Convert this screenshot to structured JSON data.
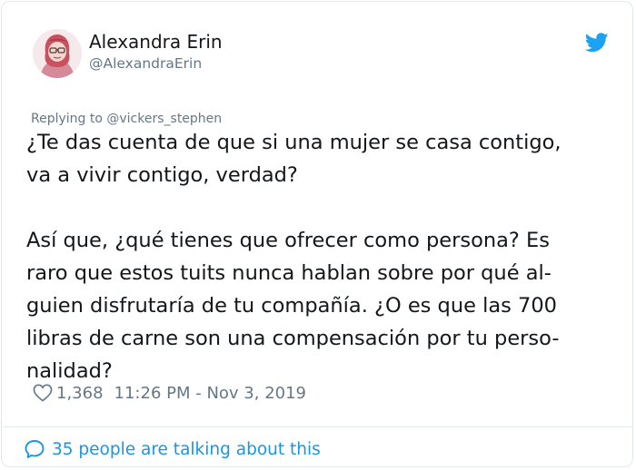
{
  "author": {
    "display_name": "Alexandra Erin",
    "handle": "@AlexandraErin",
    "avatar_icon": "avatar-illustration"
  },
  "brand_icon": "twitter-bird-icon",
  "colors": {
    "twitter_blue": "#1da1f2",
    "link_blue": "#1b95e0",
    "text_primary": "#14171a",
    "text_secondary": "#657786",
    "border": "#e1e8ed"
  },
  "reply_context": "Replying to @vickers_stephen",
  "tweet": {
    "lines_para1": [
      "¿Te das cuenta de que si una mujer se casa contigo,",
      "va a vivir contigo, verdad?"
    ],
    "lines_para2": [
      "Así que, ¿qué tienes que ofrecer como persona? Es",
      "raro que estos tuits nunca hablan sobre por qué al-",
      "guien disfrutaría de tu compañía. ¿O es que las 700",
      "libras de carne son una compensación por tu perso-",
      "nalidad?"
    ]
  },
  "meta": {
    "likes": "1,368",
    "timestamp": "11:26 PM - Nov 3, 2019"
  },
  "footer": {
    "talking_label": "35 people are talking about this"
  }
}
